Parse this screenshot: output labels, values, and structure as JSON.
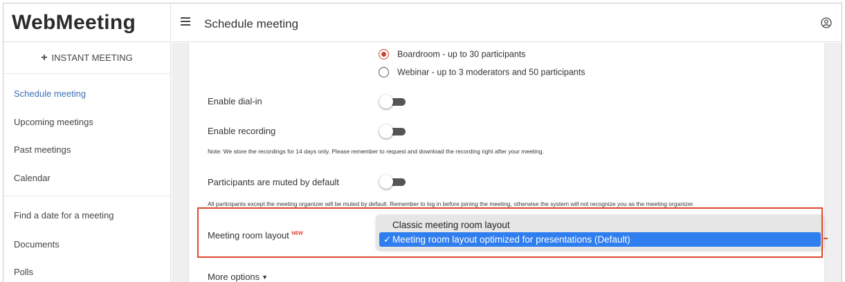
{
  "app": {
    "brand": "WebMeeting"
  },
  "header": {
    "title": "Schedule meeting",
    "menu_icon": "hamburger-menu-icon",
    "account_icon": "account-circle-icon"
  },
  "sidebar": {
    "instant_meeting": "INSTANT MEETING",
    "items": [
      {
        "label": "Schedule meeting",
        "active": true
      },
      {
        "label": "Upcoming meetings"
      },
      {
        "label": "Past meetings"
      },
      {
        "label": "Calendar"
      },
      {
        "label": "Find a date for a meeting"
      },
      {
        "label": "Documents"
      },
      {
        "label": "Polls"
      }
    ]
  },
  "form": {
    "room_types": [
      {
        "label": "Boardroom - up to 30 participants",
        "selected": true
      },
      {
        "label": "Webinar - up to 3 moderators and 50 participants",
        "selected": false
      }
    ],
    "dial_in": {
      "label": "Enable dial-in",
      "enabled": false
    },
    "recording": {
      "label": "Enable recording",
      "enabled": false,
      "note": "Note: We store the recordings for 14 days only. Please remember to request and download the recording right after your meeting."
    },
    "muted": {
      "label": "Participants are muted by default",
      "enabled": false,
      "note": "All participants except the meeting organizer will be muted by default. Remember to log in before joining the meeting, otherwise the system will not recognize you as the meeting organizer."
    },
    "layout": {
      "label": "Meeting room layout",
      "badge": "NEW",
      "options": [
        {
          "label": "Classic meeting room layout",
          "selected": false
        },
        {
          "label": "Meeting room layout optimized for presentations (Default)",
          "selected": true
        }
      ],
      "check_mark": "✓"
    },
    "more_options": "More options"
  },
  "colors": {
    "accent_radio": "#c8442a",
    "active_nav": "#3d6fb5",
    "highlight_border": "#e0452e",
    "selected_option": "#2f7ef0"
  }
}
